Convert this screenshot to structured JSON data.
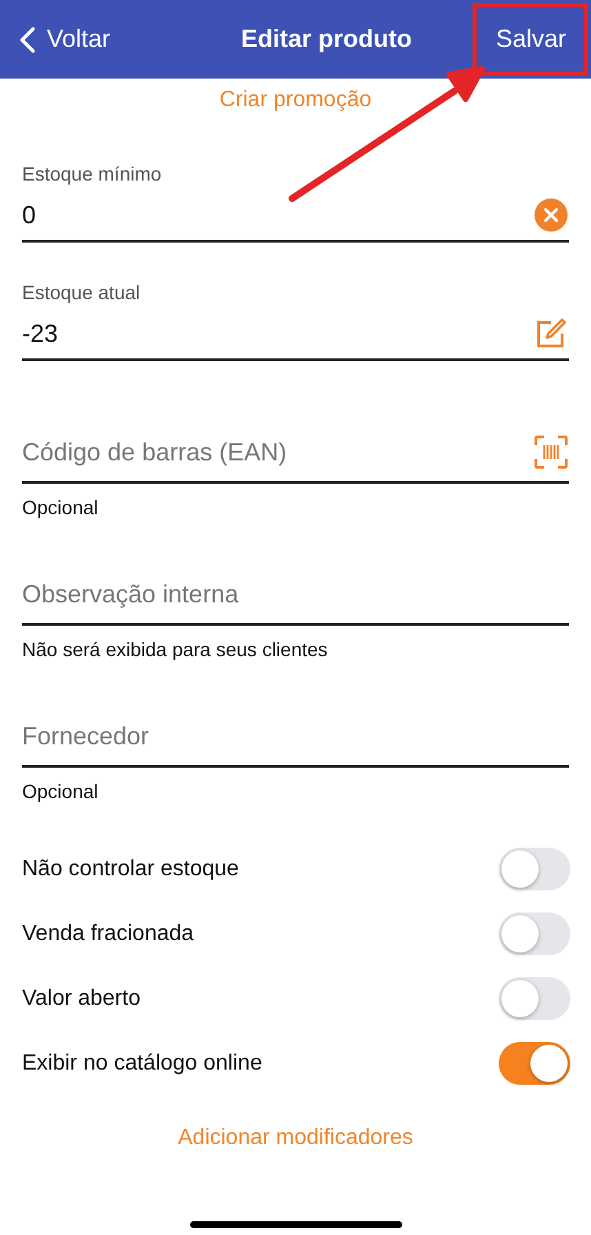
{
  "header": {
    "back": "Voltar",
    "title": "Editar produto",
    "save": "Salvar"
  },
  "promo_link": "Criar promoção",
  "fields": [
    {
      "kind": "filled",
      "label": "Estoque mínimo",
      "value": "0",
      "trailing_button": {
        "kind": "clear"
      }
    },
    {
      "kind": "filled",
      "label": "Estoque atual",
      "value": "-23",
      "trailing_button": {
        "kind": "edit"
      }
    },
    {
      "kind": "empty",
      "placeholder": "Código de barras (EAN)",
      "helper": "Opcional",
      "trailing_button": {
        "kind": "scan"
      }
    },
    {
      "kind": "empty",
      "placeholder": "Observação interna",
      "helper": "Não será exibida para seus clientes"
    },
    {
      "kind": "empty",
      "placeholder": "Fornecedor",
      "helper": "Opcional"
    }
  ],
  "toggles": [
    {
      "label": "Não controlar estoque",
      "on": false
    },
    {
      "label": "Venda fracionada",
      "on": false
    },
    {
      "label": "Valor aberto",
      "on": false
    },
    {
      "label": "Exibir no catálogo online",
      "on": true
    }
  ],
  "modifiers_link": "Adicionar modificadores",
  "annotation": {
    "highlight_box": true,
    "arrow": true
  }
}
